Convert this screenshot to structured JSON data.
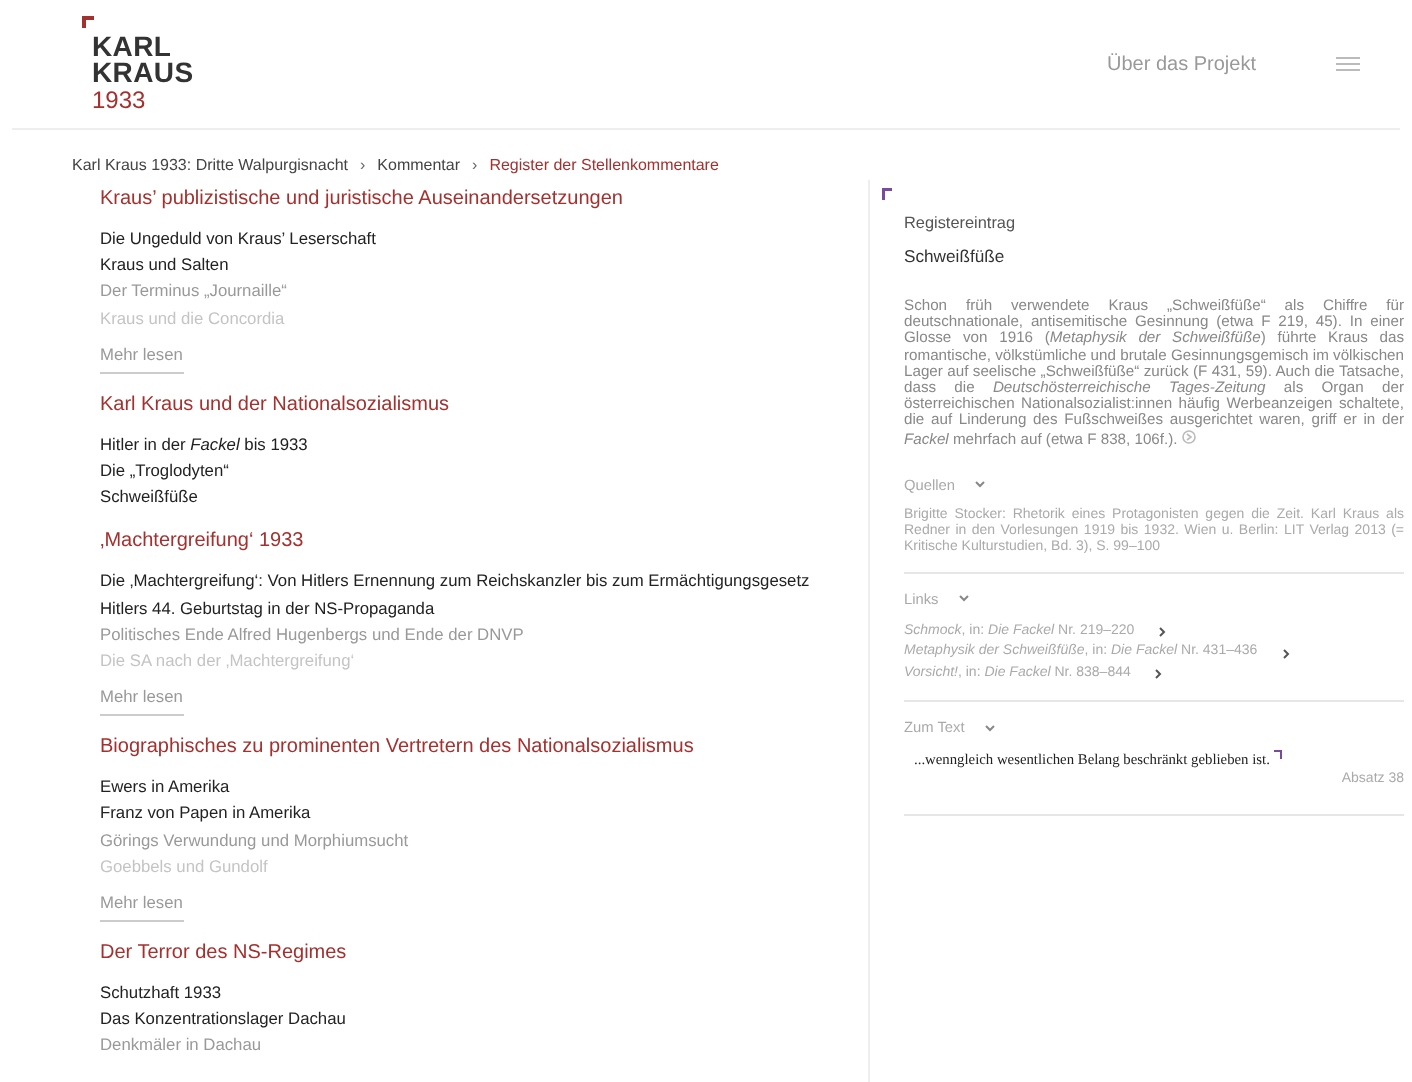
{
  "header": {
    "logo": {
      "line_1": "KARL",
      "line_2": "KRAUS",
      "year": "1933"
    },
    "nav_link": "Über das Projekt"
  },
  "breadcrumb_separator": "›",
  "breadcrumb": [
    {
      "label": "Karl Kraus 1933: Dritte Walpurgisnacht",
      "current": false
    },
    {
      "label": "Kommentar",
      "current": false
    },
    {
      "label": "Register der Stellenkommentare",
      "current": true
    }
  ],
  "sections": [
    {
      "title": "Kraus’ publizistische und juristische Auseinandersetzungen",
      "items": [
        {
          "text": "Die Ungeduld von Kraus’ Leserschaft",
          "kind": "normal"
        },
        {
          "text": "Kraus und Salten",
          "kind": "normal"
        },
        {
          "text": "Der Terminus „Journaille“",
          "kind": "dim"
        },
        {
          "text": "Kraus und die Concordia",
          "kind": "faint"
        }
      ],
      "more": "Mehr lesen"
    },
    {
      "title": "Karl Kraus und der Nationalsozialismus",
      "items": [
        {
          "text": "Hitler in der *Fackel* bis 1933",
          "kind": "normal"
        },
        {
          "text": "Die „Troglodyten“",
          "kind": "normal"
        },
        {
          "text": "Schweißfüße",
          "kind": "normal"
        }
      ]
    },
    {
      "title": "‚Machtergreifung‘ 1933",
      "items": [
        {
          "text": "Die ‚Machtergreifung‘: Von Hitlers Ernennung zum Reichskanzler bis zum Ermächtigungsgesetz",
          "kind": "normal"
        },
        {
          "text": "Hitlers 44. Geburtstag in der NS-Propaganda",
          "kind": "normal"
        },
        {
          "text": "Politisches Ende Alfred Hugenbergs und Ende der DNVP",
          "kind": "dim"
        },
        {
          "text": "Die SA nach der ‚Machtergreifung‘",
          "kind": "faint"
        }
      ],
      "more": "Mehr lesen"
    },
    {
      "title": "Biographisches zu prominenten Vertretern des Nationalsozialismus",
      "items": [
        {
          "text": "Ewers in Amerika",
          "kind": "normal"
        },
        {
          "text": "Franz von Papen in Amerika",
          "kind": "normal"
        },
        {
          "text": "Görings Verwundung und Morphiumsucht",
          "kind": "dim"
        },
        {
          "text": "Goebbels und Gundolf",
          "kind": "faint"
        }
      ],
      "more": "Mehr lesen"
    },
    {
      "title": "Der Terror des NS-Regimes",
      "items": [
        {
          "text": "Schutzhaft 1933",
          "kind": "normal"
        },
        {
          "text": "Das Konzentrationslager Dachau",
          "kind": "normal"
        },
        {
          "text": "Denkmäler in Dachau",
          "kind": "dim"
        }
      ]
    }
  ],
  "entry": {
    "label": "Registereintrag",
    "title": "Schweißfüße",
    "text": "Schon früh verwendete Kraus „Schweißfüße“ als Chiffre für deutschnationale, antisemitische Gesinnung (etwa F 219, 45). In einer Glosse von 1916 (*Metaphysik der Schweißfüße*) führte Kraus das romantische, völkstümliche und brutale Gesinnungsgemisch im völkischen Lager auf seelische „Schweißfüße“ zurück (F 431, 59). Auch die Tatsache, dass die *Deutschösterreichische Tages-Zeitung* als Organ der österreichischen Nationalsozialist:innen häufig Werbeanzeigen schaltete, die auf Linderung des Fußschweißes ausgerichtet waren, griff er in der *Fackel* mehrfach auf (etwa F 838, 106f.).",
    "panels": [
      {
        "kind": "sources",
        "label": "Quellen",
        "expanded": true,
        "text": "Brigitte Stocker: Rhetorik eines Protagonisten gegen die Zeit. Karl Kraus als Redner in den Vorlesungen 1919 bis 1932. Wien u. Berlin: LIT Verlag 2013 (= Kritische Kulturstudien, Bd. 3), S. 99–100"
      },
      {
        "kind": "links",
        "label": "Links",
        "expanded": true,
        "links": [
          "*Schmock*, in: *Die Fackel* Nr. 219–220",
          "*Metaphysik der Schweißfüße*, in: *Die Fackel* Nr. 431–436",
          "*Vorsicht!*, in: *Die Fackel* Nr. 838–844"
        ]
      },
      {
        "kind": "quote",
        "label": "Zum Text",
        "expanded": true,
        "quote": "...wenngleich wesentlichen Belang beschränkt geblieben ist.",
        "paragraph": "Absatz 38"
      }
    ]
  }
}
